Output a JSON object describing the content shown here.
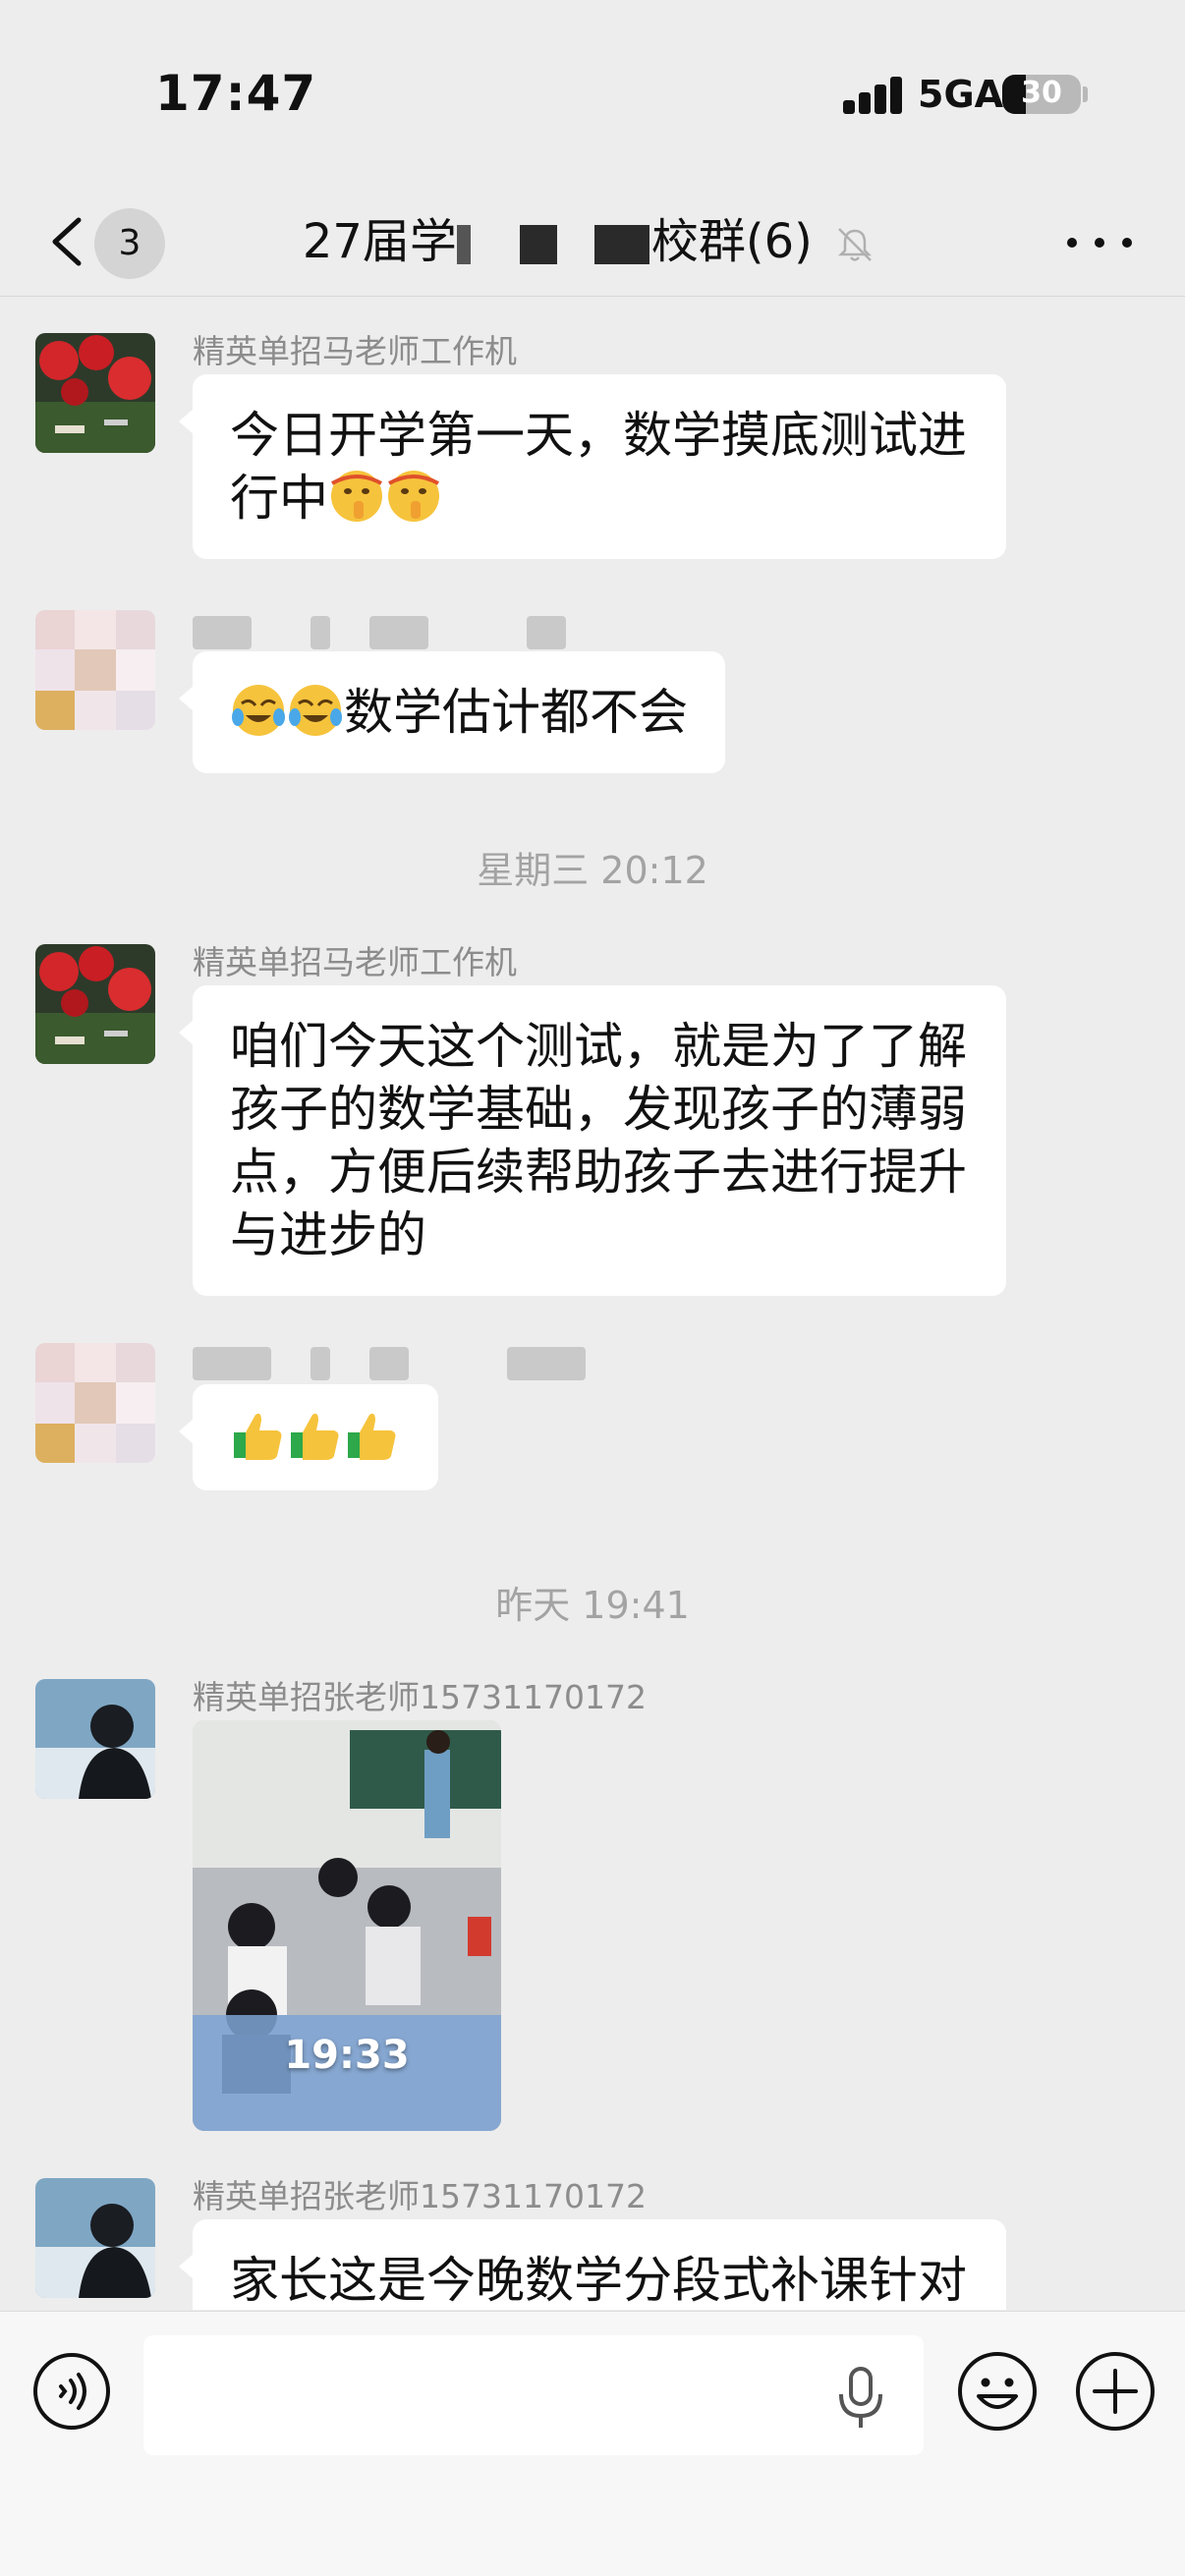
{
  "status_bar": {
    "time": "17:47",
    "network": "5GA",
    "battery_percent": "30",
    "battery_level": 0.3
  },
  "nav": {
    "unread_count": "3",
    "title_parts": [
      "27届学",
      "校群(6)"
    ],
    "muted": true
  },
  "messages": [
    {
      "sender": "精英单招马老师工作机",
      "text": "今日开学第一天，数学摸底测试进行中",
      "emojis": [
        "shushing-face-emoji",
        "shushing-face-emoji"
      ]
    },
    {
      "sender_blurred": true,
      "emojis": [
        "crying-laughing-emoji",
        "crying-laughing-emoji"
      ],
      "text": "数学估计都不会"
    },
    {
      "timestamp": "星期三 20:12"
    },
    {
      "sender": "精英单招马老师工作机",
      "text": "咱们今天这个测试，就是为了了解孩子的数学基础，发现孩子的薄弱点，方便后续帮助孩子去进行提升与进步的"
    },
    {
      "sender_blurred": true,
      "emojis": [
        "thumbs-up-emoji",
        "thumbs-up-emoji",
        "thumbs-up-emoji"
      ]
    },
    {
      "timestamp": "昨天 19:41"
    },
    {
      "sender": "精英单招张老师15731170172",
      "image_overlay_time": "19:33"
    },
    {
      "sender": "精英单招张老师15731170172",
      "text": "家长这是今晚数学分段式补课针对"
    }
  ],
  "input": {
    "placeholder": ""
  },
  "colors": {
    "background": "#ededed",
    "bubble": "#ffffff",
    "sender": "#8c8c8c",
    "timestamp": "#a3a3a3"
  }
}
